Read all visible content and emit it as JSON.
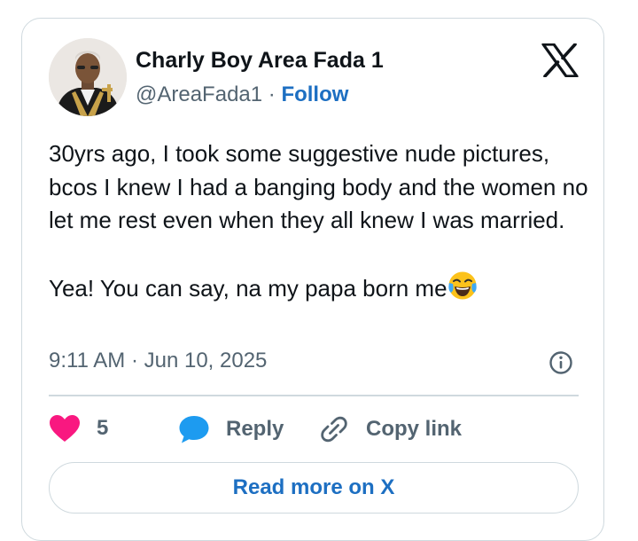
{
  "tweet": {
    "display_name": "Charly Boy Area Fada 1",
    "handle": "@AreaFada1",
    "separator": " · ",
    "follow_label": "Follow",
    "paragraphs": [
      "30yrs ago, I took some suggestive nude pictures, bcos I knew I had a banging body and the women no let me rest even when they all knew I was married.",
      "Yea! You can say, na my papa born me"
    ],
    "emoji": "face-with-tears-of-joy",
    "timestamp": "9:11 AM · Jun 10, 2025"
  },
  "actions": {
    "like_count": "5",
    "reply_label": "Reply",
    "copy_label": "Copy link"
  },
  "read_more_label": "Read more on X",
  "icons": [
    "avatar",
    "x-logo-icon",
    "info-icon",
    "heart-icon",
    "reply-bubble-icon",
    "link-icon",
    "laughing-emoji-icon"
  ],
  "colors": {
    "text": "#0f1419",
    "secondary": "#536471",
    "link": "#1d6fc2",
    "heart": "#f91880",
    "reply": "#1d9bf0",
    "border": "#cfd9de"
  }
}
